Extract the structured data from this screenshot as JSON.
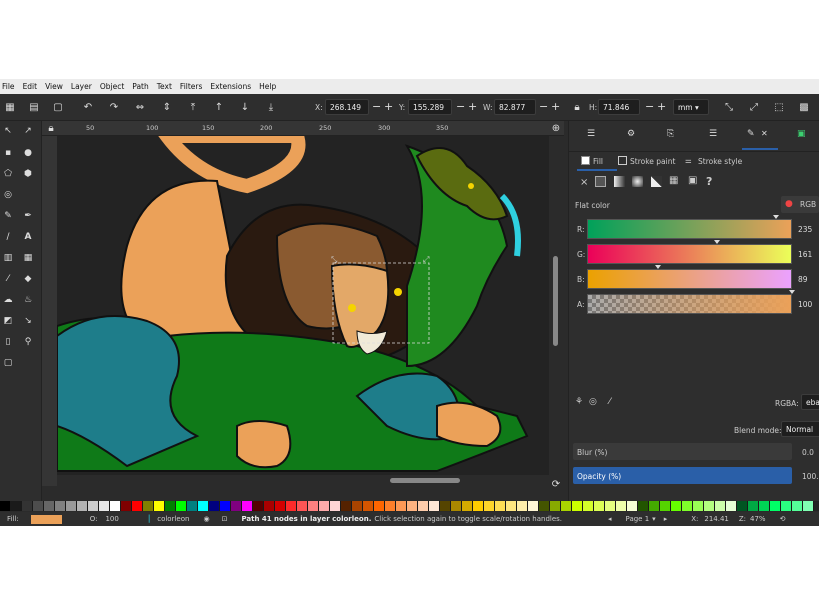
{
  "menu": [
    "File",
    "Edit",
    "View",
    "Layer",
    "Object",
    "Path",
    "Text",
    "Filters",
    "Extensions",
    "Help"
  ],
  "toolbar": {
    "x_label": "X:",
    "x_value": "268.149",
    "y_label": "Y:",
    "y_value": "155.289",
    "w_label": "W:",
    "w_value": "82.877",
    "h_label": "H:",
    "h_value": "71.846",
    "unit": "mm"
  },
  "ruler": {
    "ticks": [
      "50",
      "100",
      "150",
      "200",
      "250",
      "300",
      "350"
    ]
  },
  "panel": {
    "fill_tab": "Fill",
    "stroke_paint_tab": "Stroke paint",
    "stroke_style_tab": "Stroke style",
    "paint_type_labels": [
      "×",
      "?"
    ],
    "flat_color_label": "Flat color",
    "color_mode": "RGB",
    "channels": [
      {
        "label": "R:",
        "value": "235"
      },
      {
        "label": "G:",
        "value": "161"
      },
      {
        "label": "B:",
        "value": "89"
      },
      {
        "label": "A:",
        "value": "100"
      }
    ],
    "rgba_label": "RGBA:",
    "rgba_value": "eba",
    "blend_mode_label": "Blend mode:",
    "blend_mode_value": "Normal",
    "blur_label": "Blur (%)",
    "blur_value": "0.0",
    "opacity_label": "Opacity (%)",
    "opacity_value": "100.0"
  },
  "colors": {
    "fill_swatch": "#eba159",
    "accent": "#2a5fa8"
  },
  "status": {
    "fill_label": "Fill:",
    "opacity_label": "O:",
    "opacity_value": "100",
    "layer_name": "colorleon",
    "message_bold": "Path 41 nodes in layer colorleon.",
    "message_rest": "Click selection again to toggle scale/rotation handles.",
    "page_label": "Page 1",
    "x_label": "X:",
    "x_value": "214.41",
    "zoom_label": "Z:",
    "zoom_value": "47%"
  }
}
